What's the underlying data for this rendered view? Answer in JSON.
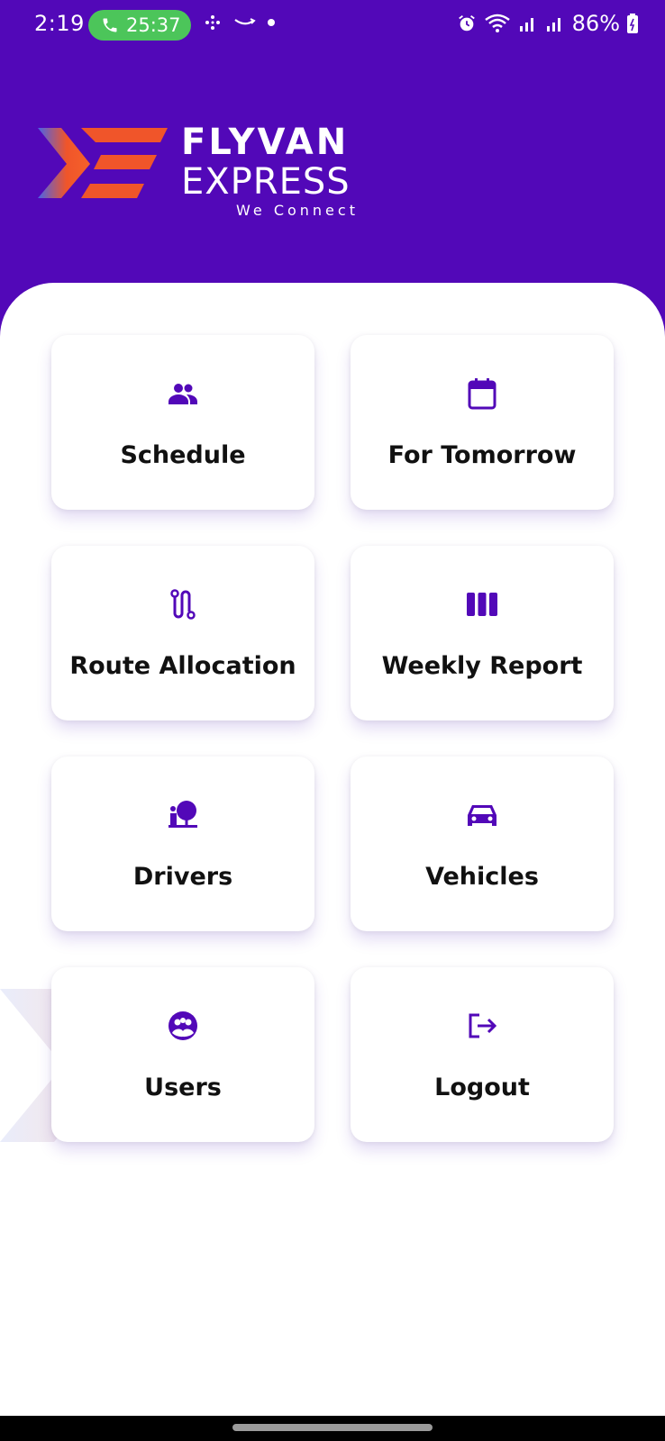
{
  "status_bar": {
    "time": "2:19",
    "call_timer": "25:37",
    "battery": "86%"
  },
  "brand": {
    "name_line1": "FLYVAN",
    "name_line2": "EXPRESS",
    "tagline": "We Connect",
    "primary_color": "#5208b8",
    "accent_color": "#f0552a"
  },
  "menu": {
    "items": [
      {
        "label": "Schedule",
        "icon": "people-icon"
      },
      {
        "label": "For Tomorrow",
        "icon": "calendar-icon"
      },
      {
        "label": "Route Allocation",
        "icon": "route-icon"
      },
      {
        "label": "Weekly Report",
        "icon": "columns-icon"
      },
      {
        "label": "Drivers",
        "icon": "driver-icon"
      },
      {
        "label": "Vehicles",
        "icon": "car-icon"
      },
      {
        "label": "Users",
        "icon": "users-circle-icon"
      },
      {
        "label": "Logout",
        "icon": "logout-icon"
      }
    ]
  }
}
